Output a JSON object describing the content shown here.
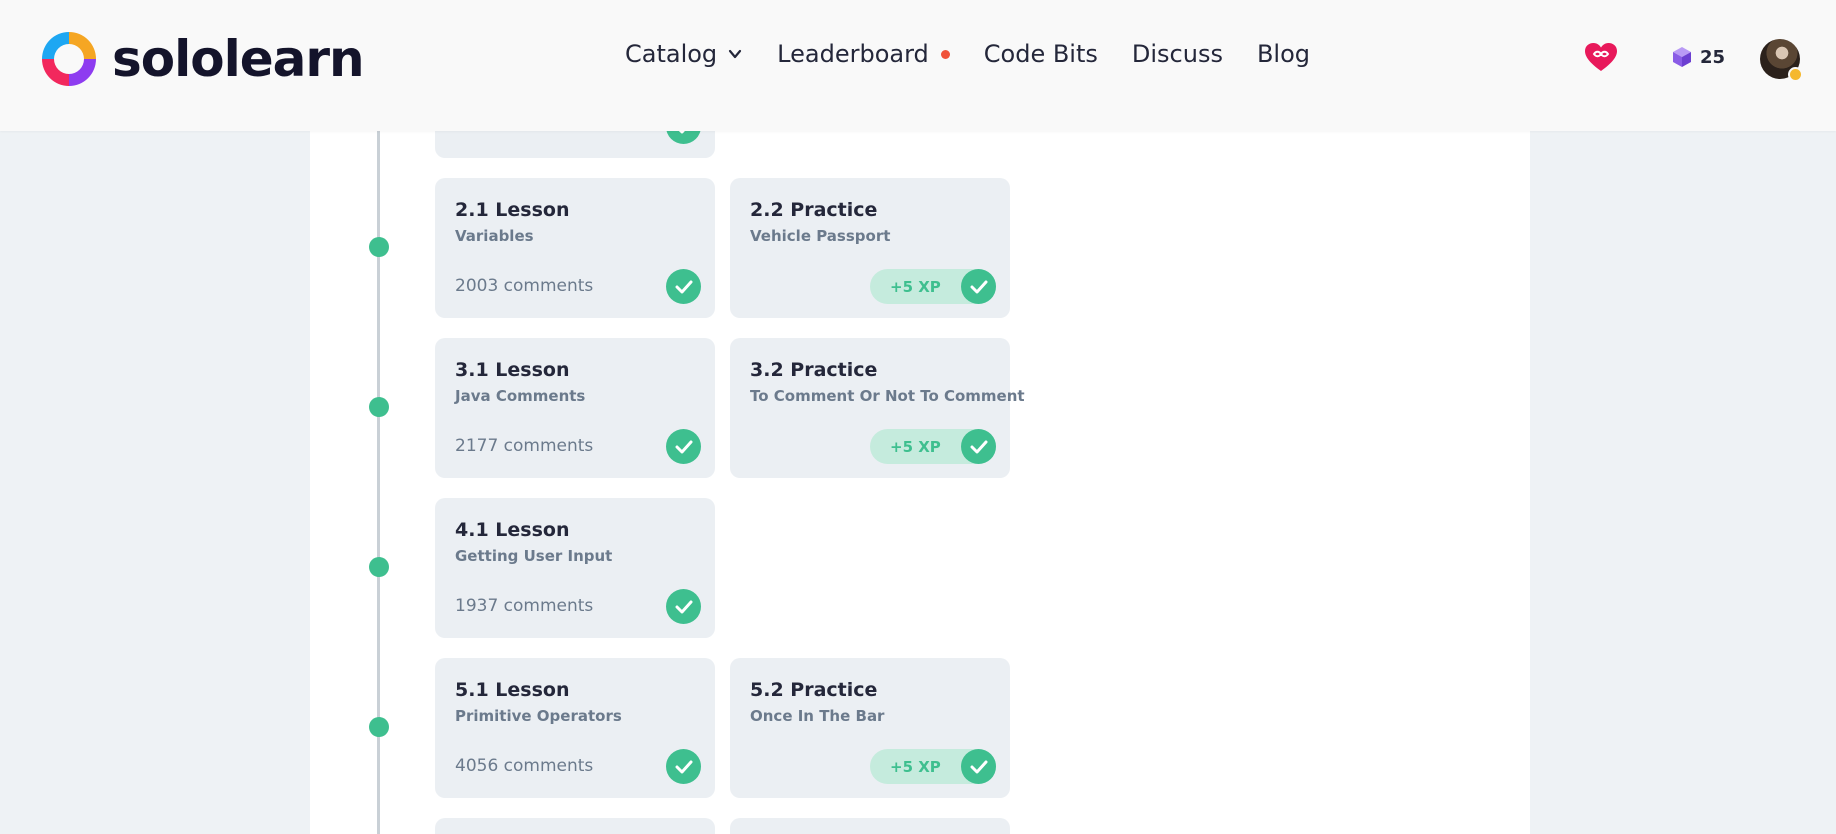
{
  "brand": {
    "name": "sololearn"
  },
  "nav": {
    "catalog": "Catalog",
    "leaderboard": "Leaderboard",
    "code_bits": "Code Bits",
    "discuss": "Discuss",
    "blog": "Blog"
  },
  "header": {
    "bits_count": "25",
    "heart_icon": "infinite-heart-icon",
    "bits_icon": "bits-cube-icon"
  },
  "lessons": [
    {
      "title": "2.1 Lesson",
      "subtitle": "Variables",
      "comments": "2003 comments"
    },
    {
      "title": "2.2 Practice",
      "subtitle": "Vehicle Passport",
      "xp": "+5 XP"
    },
    {
      "title": "3.1 Lesson",
      "subtitle": "Java Comments",
      "comments": "2177 comments"
    },
    {
      "title": "3.2 Practice",
      "subtitle": "To Comment Or Not To Comment",
      "xp": "+5 XP"
    },
    {
      "title": "4.1 Lesson",
      "subtitle": "Getting User Input",
      "comments": "1937 comments"
    },
    {
      "title": "5.1 Lesson",
      "subtitle": "Primitive Operators",
      "comments": "4056 comments"
    },
    {
      "title": "5.2 Practice",
      "subtitle": "Once In The Bar",
      "xp": "+5 XP"
    }
  ],
  "colors": {
    "accent_green": "#3ebf8f",
    "notification_dot": "#f0533b",
    "card_bg": "#ebeff3"
  }
}
